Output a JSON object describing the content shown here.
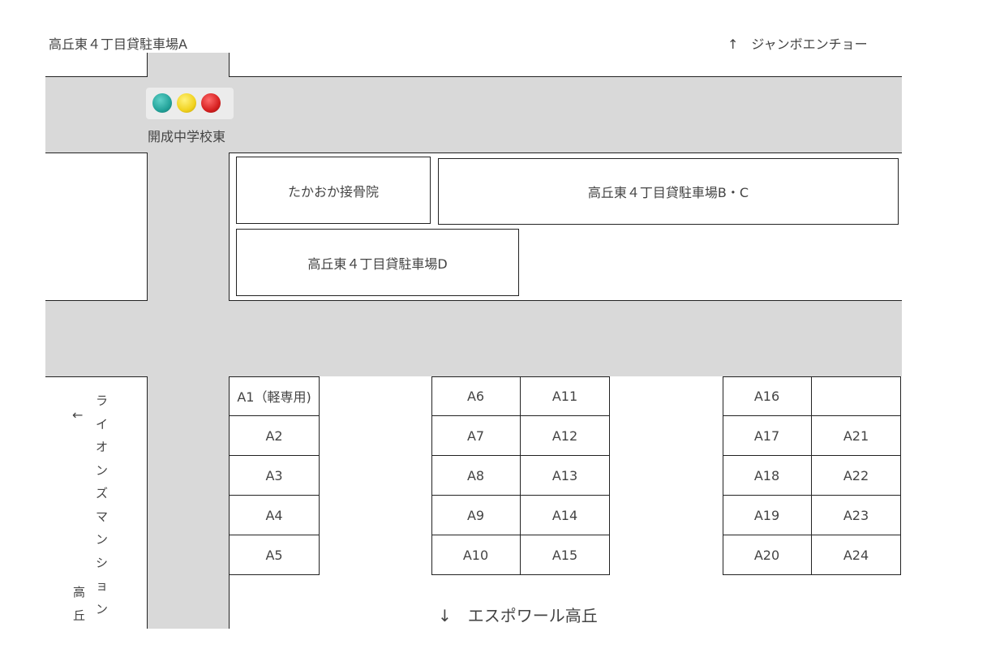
{
  "title_top_left": "高丘東４丁目貸駐車場A",
  "direction_top_right": "↑　ジャンボエンチョー",
  "signal": {
    "label": "開成中学校東",
    "colors": {
      "green": "#23a39a",
      "yellow": "#f1d21f",
      "red": "#d62020"
    }
  },
  "buildings": {
    "takaoka_clinic": "たかおか接骨院",
    "parking_bc": "高丘東４丁目貸駐車場B・C",
    "parking_d": "高丘東４丁目貸駐車場D"
  },
  "left_arrow": "←",
  "lions_mansion_chars": [
    "ラ",
    "イ",
    "オ",
    "ン",
    "ズ",
    "マ",
    "ン",
    "シ",
    "ョ",
    "ン"
  ],
  "takaoka_chars": [
    "高",
    "丘"
  ],
  "bottom_direction": "↓　エスポワール高丘",
  "parking_spaces": {
    "col1": [
      "A1（軽専用)",
      "A2",
      "A3",
      "A4",
      "A5"
    ],
    "col2": [
      "A6",
      "A7",
      "A8",
      "A9",
      "A10"
    ],
    "col3": [
      "A11",
      "A12",
      "A13",
      "A14",
      "A15"
    ],
    "col4": [
      "A16",
      "A17",
      "A18",
      "A19",
      "A20"
    ],
    "col5": [
      "",
      "A21",
      "A22",
      "A23",
      "A24"
    ]
  },
  "road_color": "#d9d9d9"
}
